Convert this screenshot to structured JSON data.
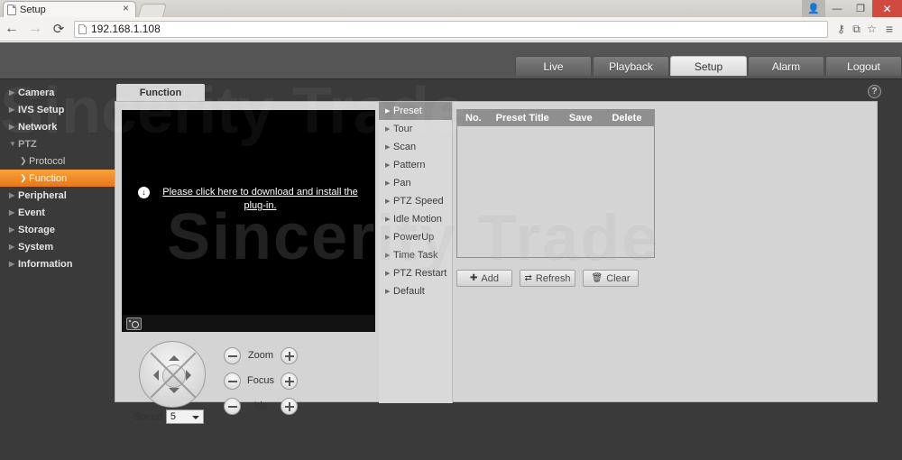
{
  "browser": {
    "tab_title": "Setup",
    "tab_close_label": "×",
    "url": "192.168.1.108",
    "back_icon": "←",
    "forward_icon": "→",
    "reload_icon": "⟳",
    "key_icon": "⚷",
    "translate_icon": "⧉",
    "star_icon": "☆",
    "menu_icon": "≡",
    "user_icon": "■",
    "minimize_icon": "—",
    "maximize_icon": "❐",
    "close_icon": "✕"
  },
  "device": {
    "main_menu": [
      {
        "label": "Live",
        "active": false
      },
      {
        "label": "Playback",
        "active": false
      },
      {
        "label": "Setup",
        "active": true
      },
      {
        "label": "Alarm",
        "active": false
      },
      {
        "label": "Logout",
        "active": false
      }
    ],
    "sidebar": [
      {
        "label": "Camera",
        "type": "group",
        "expanded": false
      },
      {
        "label": "IVS Setup",
        "type": "group",
        "expanded": false
      },
      {
        "label": "Network",
        "type": "group",
        "expanded": false
      },
      {
        "label": "PTZ",
        "type": "group",
        "expanded": true
      },
      {
        "label": "Protocol",
        "type": "sub",
        "active": false
      },
      {
        "label": "Function",
        "type": "sub",
        "active": true
      },
      {
        "label": "Peripheral",
        "type": "group",
        "expanded": false
      },
      {
        "label": "Event",
        "type": "group",
        "expanded": false
      },
      {
        "label": "Storage",
        "type": "group",
        "expanded": false
      },
      {
        "label": "System",
        "type": "group",
        "expanded": false
      },
      {
        "label": "Information",
        "type": "group",
        "expanded": false
      }
    ],
    "tab_label": "Function",
    "help_label": "?",
    "video": {
      "plugin_message": "Please click here to download and install the plug-in.",
      "download_icon": "↓",
      "snapshot_icon": "camera-icon"
    },
    "ptz_controls": {
      "speed_label": "Speed",
      "speed_value": "5",
      "lens": [
        {
          "label": "Zoom",
          "minus": "−",
          "plus": "+"
        },
        {
          "label": "Focus",
          "minus": "−",
          "plus": "+"
        },
        {
          "label": "Iris",
          "minus": "−",
          "plus": "+"
        }
      ]
    },
    "function_list": [
      {
        "label": "Preset",
        "active": true
      },
      {
        "label": "Tour",
        "active": false
      },
      {
        "label": "Scan",
        "active": false
      },
      {
        "label": "Pattern",
        "active": false
      },
      {
        "label": "Pan",
        "active": false
      },
      {
        "label": "PTZ Speed",
        "active": false
      },
      {
        "label": "Idle Motion",
        "active": false
      },
      {
        "label": "PowerUp",
        "active": false
      },
      {
        "label": "Time Task",
        "active": false
      },
      {
        "label": "PTZ Restart",
        "active": false
      },
      {
        "label": "Default",
        "active": false
      }
    ],
    "preset_table": {
      "columns": [
        "No.",
        "Preset Title",
        "Save",
        "Delete"
      ],
      "rows": [],
      "buttons": [
        {
          "label": "Add",
          "icon": "✚"
        },
        {
          "label": "Refresh",
          "icon": "⇄"
        },
        {
          "label": "Clear",
          "icon": "🗑"
        }
      ]
    },
    "watermark": "Sincerity Trade"
  },
  "colors": {
    "accent_orange": "#e8761a",
    "header_gray": "#555555",
    "panel_gray": "#d4d4d4",
    "sidebar_dark": "#3a3a3a",
    "close_red": "#d04a3f"
  }
}
